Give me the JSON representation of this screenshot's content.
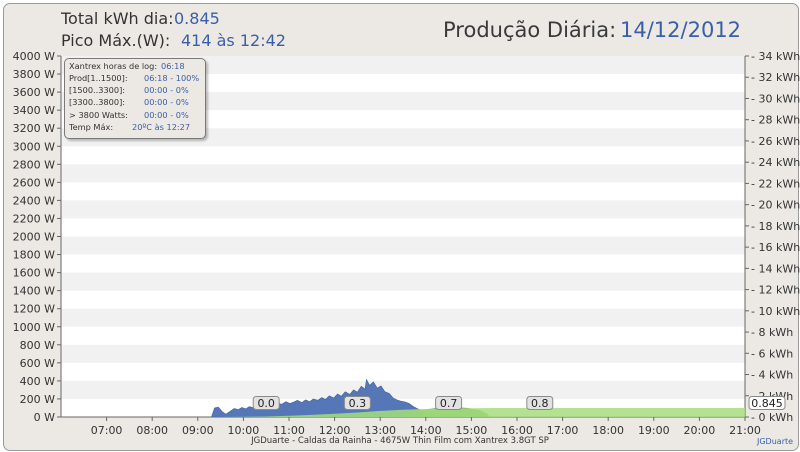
{
  "header": {
    "total_label": "Total kWh dia:",
    "total_value": "0.845",
    "peak_label": "Pico Máx.(W):",
    "peak_value": "414 às 12:42",
    "title_label": "Produção Diária:",
    "title_date": "14/12/2012"
  },
  "info_box": {
    "rows": [
      {
        "label": "Xantrex horas de log:",
        "value": "06:18"
      },
      {
        "label": "Prod[1..1500]:",
        "value": "06:18 - 100%"
      },
      {
        "label": "[1500..3300]:",
        "value": "00:00 - 0%"
      },
      {
        "label": "[3300..3800]:",
        "value": "00:00 - 0%"
      },
      {
        "label": "> 3800 Watts:",
        "value": "00:00 - 0%"
      },
      {
        "label": "Temp Máx:",
        "value": "20ºC às 12:27"
      }
    ]
  },
  "footer": {
    "credit": "JGDuarte  -  Caldas da Rainha  -  4675W Thin Film com Xantrex 3.8GT SP",
    "author": "JGDuarte"
  },
  "colors": {
    "power_area": "#5577b8",
    "energy_area": "#5f9e52",
    "energy_line": "#a6dd7c",
    "bg": "#ece9e4",
    "value_text": "#3a5fa8"
  },
  "chart_data": {
    "type": "area",
    "x_ticks": [
      "07:00",
      "08:00",
      "09:00",
      "10:00",
      "11:00",
      "12:00",
      "13:00",
      "14:00",
      "15:00",
      "16:00",
      "17:00",
      "18:00",
      "19:00",
      "20:00",
      "21:00"
    ],
    "xlim": [
      "06:00",
      "21:00"
    ],
    "y_left": {
      "unit": "W",
      "ylim": [
        0,
        4000
      ],
      "ticks": [
        "0 W",
        "200 W",
        "400 W",
        "600 W",
        "800 W",
        "1000 W",
        "1200 W",
        "1400 W",
        "1600 W",
        "1800 W",
        "2000 W",
        "2200 W",
        "2400 W",
        "2600 W",
        "2800 W",
        "3000 W",
        "3200 W",
        "3400 W",
        "3600 W",
        "3800 W",
        "4000 W"
      ]
    },
    "y_right": {
      "unit": "kWh",
      "ylim": [
        0,
        34
      ],
      "ticks": [
        "0 kWh",
        "2 kWh",
        "4 kWh",
        "6 kWh",
        "8 kWh",
        "10 kWh",
        "12 kWh",
        "14 kWh",
        "16 kWh",
        "18 kWh",
        "20 kWh",
        "22 kWh",
        "24 kWh",
        "26 kWh",
        "28 kWh",
        "30 kWh",
        "32 kWh",
        "34 kWh"
      ]
    },
    "grid": "horizontal bands",
    "series": [
      {
        "axis": "left",
        "points": [
          [
            "09:18",
            0
          ],
          [
            "09:22",
            100
          ],
          [
            "09:27",
            110
          ],
          [
            "09:32",
            60
          ],
          [
            "09:37",
            30
          ],
          [
            "09:42",
            60
          ],
          [
            "09:48",
            95
          ],
          [
            "09:53",
            80
          ],
          [
            "09:58",
            105
          ],
          [
            "10:03",
            90
          ],
          [
            "10:08",
            115
          ],
          [
            "10:14",
            100
          ],
          [
            "10:19",
            125
          ],
          [
            "10:24",
            110
          ],
          [
            "10:29",
            130
          ],
          [
            "10:35",
            150
          ],
          [
            "10:40",
            135
          ],
          [
            "10:45",
            160
          ],
          [
            "10:50",
            140
          ],
          [
            "10:56",
            170
          ],
          [
            "11:01",
            150
          ],
          [
            "11:06",
            165
          ],
          [
            "11:11",
            185
          ],
          [
            "11:17",
            160
          ],
          [
            "11:22",
            190
          ],
          [
            "11:27",
            170
          ],
          [
            "11:32",
            200
          ],
          [
            "11:38",
            185
          ],
          [
            "11:43",
            215
          ],
          [
            "11:48",
            195
          ],
          [
            "11:53",
            235
          ],
          [
            "11:59",
            210
          ],
          [
            "12:04",
            255
          ],
          [
            "12:09",
            230
          ],
          [
            "12:14",
            280
          ],
          [
            "12:20",
            250
          ],
          [
            "12:25",
            300
          ],
          [
            "12:30",
            275
          ],
          [
            "12:35",
            340
          ],
          [
            "12:40",
            310
          ],
          [
            "12:42",
            414
          ],
          [
            "12:46",
            350
          ],
          [
            "12:51",
            390
          ],
          [
            "12:56",
            320
          ],
          [
            "13:01",
            345
          ],
          [
            "13:06",
            280
          ],
          [
            "13:12",
            260
          ],
          [
            "13:17",
            210
          ],
          [
            "13:22",
            190
          ],
          [
            "13:27",
            175
          ],
          [
            "13:33",
            165
          ],
          [
            "13:38",
            150
          ],
          [
            "13:43",
            120
          ],
          [
            "13:48",
            95
          ],
          [
            "13:54",
            70
          ],
          [
            "13:59",
            45
          ],
          [
            "14:04",
            25
          ],
          [
            "14:09",
            10
          ],
          [
            "14:15",
            0
          ]
        ]
      },
      {
        "axis": "left",
        "points": [
          [
            "13:30",
            20
          ],
          [
            "13:45",
            70
          ],
          [
            "14:10",
            95
          ],
          [
            "14:25",
            120
          ],
          [
            "14:40",
            110
          ],
          [
            "14:55",
            100
          ],
          [
            "15:10",
            80
          ],
          [
            "15:20",
            40
          ],
          [
            "15:25",
            0
          ]
        ]
      },
      {
        "axis": "right",
        "points": [
          [
            "09:20",
            0
          ],
          [
            "10:00",
            0.02
          ],
          [
            "10:30",
            0.05
          ],
          [
            "11:00",
            0.12
          ],
          [
            "11:30",
            0.2
          ],
          [
            "12:00",
            0.3
          ],
          [
            "12:30",
            0.42
          ],
          [
            "13:00",
            0.57
          ],
          [
            "13:30",
            0.68
          ],
          [
            "14:00",
            0.75
          ],
          [
            "14:30",
            0.8
          ],
          [
            "15:00",
            0.83
          ],
          [
            "15:30",
            0.845
          ],
          [
            "21:00",
            0.845
          ]
        ]
      }
    ],
    "annotations": [
      {
        "x": "10:30",
        "label": "0.0"
      },
      {
        "x": "12:30",
        "label": "0.3"
      },
      {
        "x": "14:30",
        "label": "0.7"
      },
      {
        "x": "16:30",
        "label": "0.8"
      },
      {
        "x": "21:00",
        "label": "0.845"
      }
    ]
  }
}
